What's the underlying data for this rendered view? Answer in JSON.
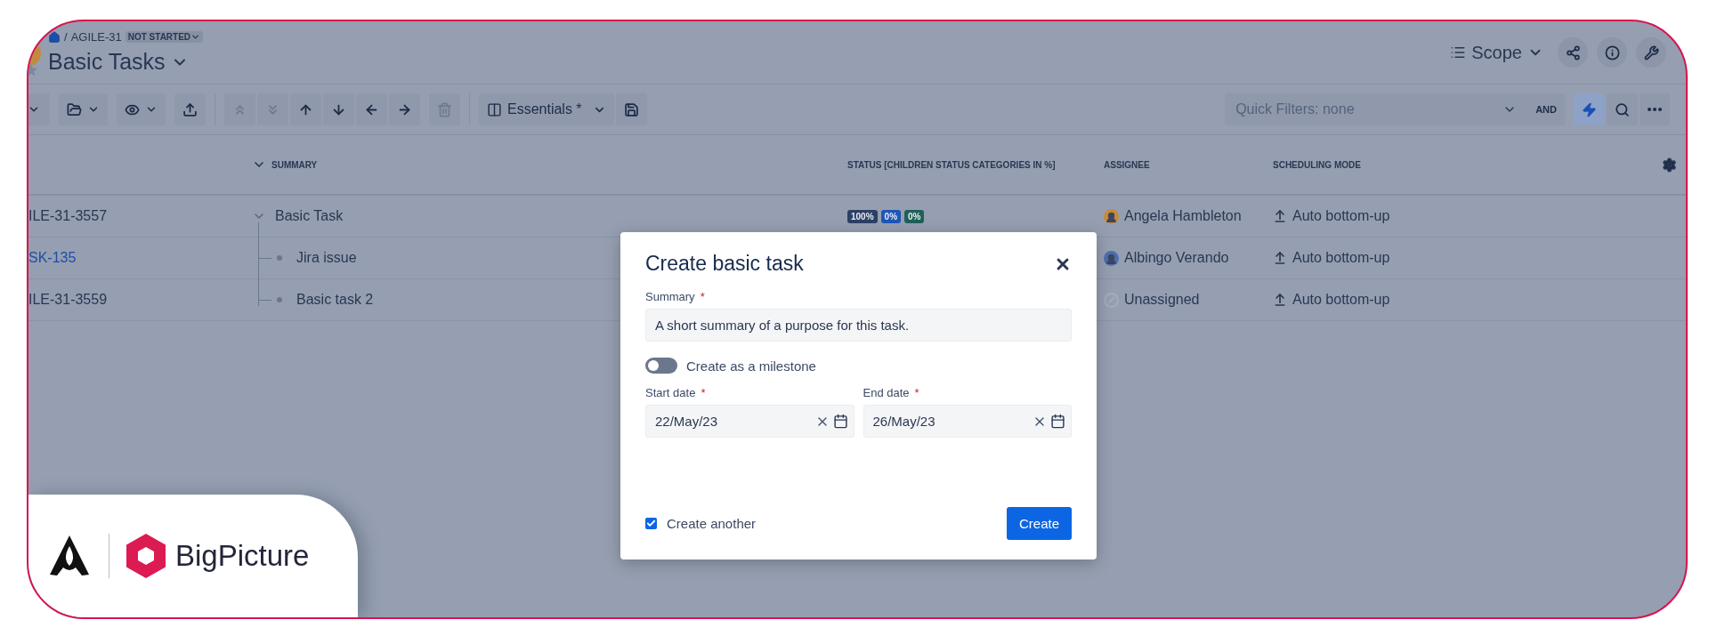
{
  "breadcrumb": {
    "separator": "/",
    "project": "AGILE-31",
    "status": "NOT STARTED"
  },
  "title": "Basic Tasks",
  "view_switcher": {
    "label": "Scope"
  },
  "toolbar": {
    "view_label": "Essentials *"
  },
  "quick_filters": {
    "placeholder": "Quick Filters: none",
    "operator": "AND",
    "lightning_on": true
  },
  "table": {
    "columns": [
      "SUMMARY",
      "STATUS [CHILDREN STATUS CATEGORIES IN %]",
      "ASSIGNEE",
      "SCHEDULING MODE"
    ],
    "rows": [
      {
        "key": "ILE-31-3557",
        "link": false,
        "summary": "Basic Task",
        "expanded": true,
        "status": [
          {
            "label": "100%",
            "color": "#2c3f66"
          },
          {
            "label": "0%",
            "color": "#1d56b5"
          },
          {
            "label": "0%",
            "color": "#1f6158"
          }
        ],
        "assignee": {
          "name": "Angela Hambleton",
          "kind": "person",
          "color": "#c98a3a"
        },
        "mode": "Auto bottom-up",
        "children": [
          {
            "key": "SK-135",
            "link": true,
            "summary": "Jira issue",
            "assignee": {
              "name": "Albingo Verando",
              "kind": "person",
              "color": "#4d6fb0"
            },
            "mode": "Auto bottom-up"
          },
          {
            "key": "ILE-31-3559",
            "link": false,
            "summary": "Basic task 2",
            "assignee": {
              "name": "Unassigned",
              "kind": "unassigned",
              "color": "#a4acb9"
            },
            "mode": "Auto bottom-up"
          }
        ]
      }
    ]
  },
  "dialog": {
    "title": "Create basic task",
    "summary": {
      "label": "Summary",
      "mark": "*",
      "value": "A short summary of a purpose for this task."
    },
    "milestone": {
      "label": "Create as a milestone",
      "on": false
    },
    "start_date": {
      "label": "Start date",
      "mark": "*",
      "value": "22/May/23"
    },
    "end_date": {
      "label": "End date",
      "mark": "*",
      "value": "26/May/23"
    },
    "create_another": {
      "label": "Create another",
      "checked": true
    },
    "button": "Create"
  },
  "brand": {
    "name": "BigPicture"
  }
}
